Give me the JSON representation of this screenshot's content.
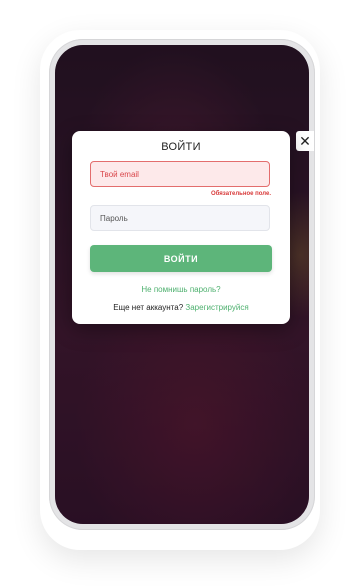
{
  "modal": {
    "title": "ВОЙТИ",
    "close_glyph": "✕",
    "email": {
      "placeholder": "Твой email",
      "value": "",
      "error": "Обязательное поле."
    },
    "password": {
      "placeholder": "Пароль",
      "value": ""
    },
    "submit_label": "ВОЙТИ",
    "forgot_link": "Не помнишь пароль?",
    "register_prompt": "Еще нет аккаунта?",
    "register_link": "Зарегистрируйся"
  },
  "colors": {
    "accent_green": "#5db57a",
    "error_red": "#d83a3a",
    "error_bg": "#fde9ea"
  },
  "icons": {
    "close": "close-icon"
  }
}
